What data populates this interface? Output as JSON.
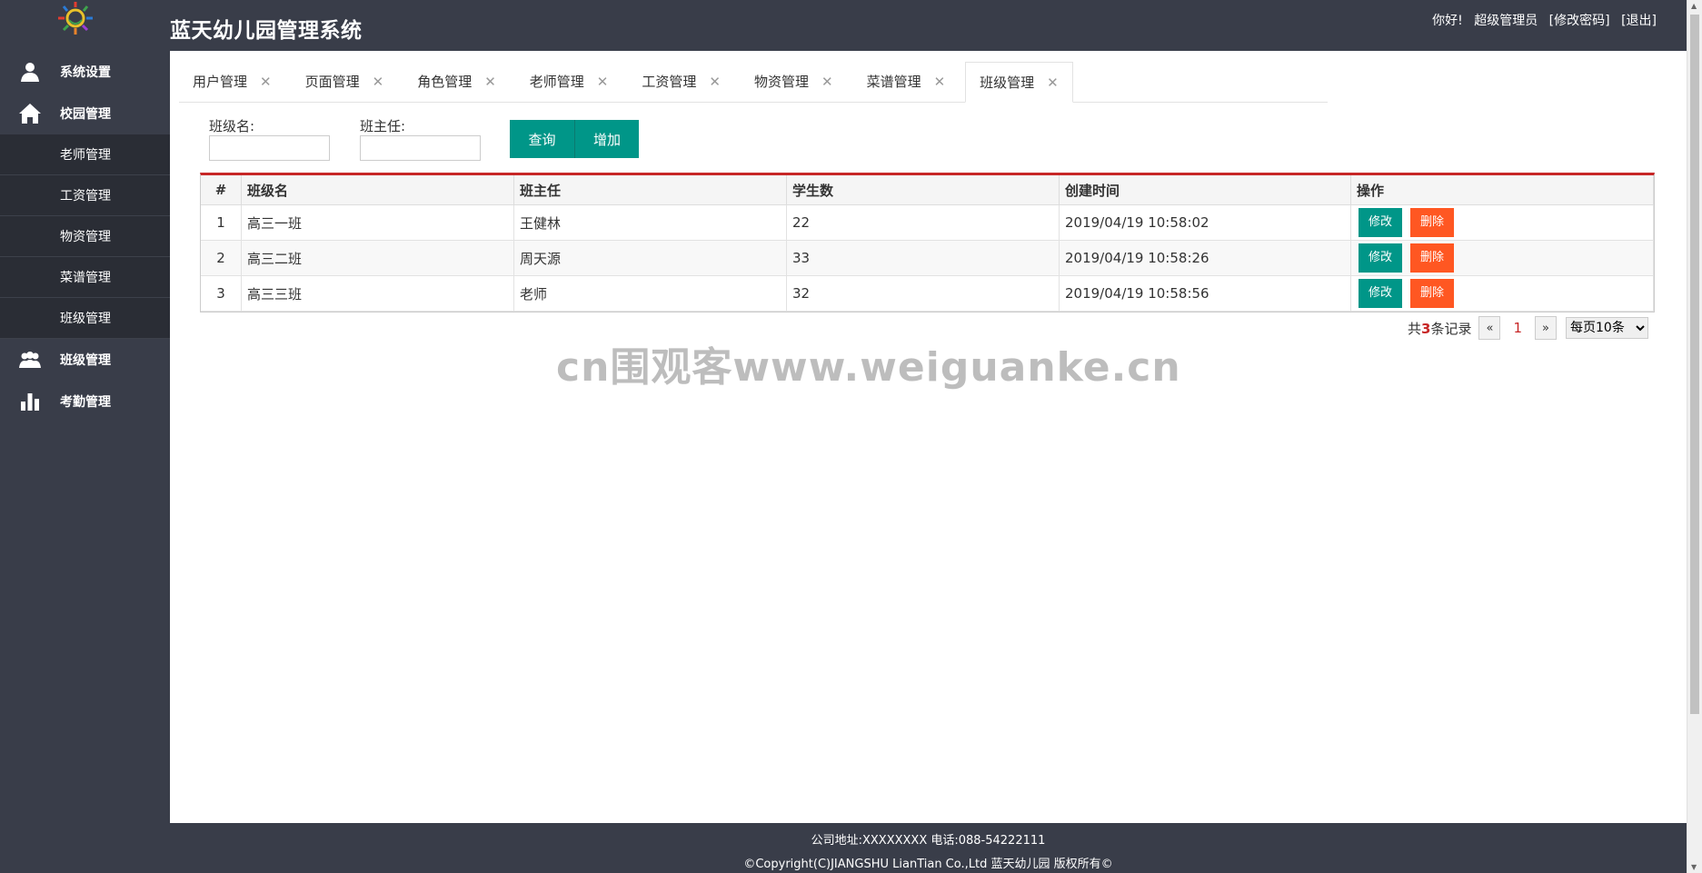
{
  "app": {
    "title": "蓝天幼儿园管理系统"
  },
  "user": {
    "greeting": "你好!",
    "name": "超级管理员",
    "change_password": "[修改密码]",
    "logout": "[退出]"
  },
  "sidebar": {
    "items": [
      {
        "label": "系统设置",
        "icon": "user-icon"
      },
      {
        "label": "校园管理",
        "icon": "home-icon"
      }
    ],
    "sub_items": [
      "老师管理",
      "工资管理",
      "物资管理",
      "菜谱管理",
      "班级管理"
    ],
    "bottom_items": [
      {
        "label": "班级管理",
        "icon": "group-icon"
      },
      {
        "label": "考勤管理",
        "icon": "bar-chart-icon"
      }
    ]
  },
  "tabs": [
    "用户管理",
    "页面管理",
    "角色管理",
    "老师管理",
    "工资管理",
    "物资管理",
    "菜谱管理",
    "班级管理"
  ],
  "active_tab": "班级管理",
  "filters": {
    "class_name_label": "班级名:",
    "class_name_value": "",
    "teacher_label": "班主任:",
    "teacher_value": "",
    "query_button": "查询",
    "add_button": "增加"
  },
  "table": {
    "columns": [
      "#",
      "班级名",
      "班主任",
      "学生数",
      "创建时间",
      "操作"
    ],
    "rows": [
      {
        "num": "1",
        "name": "高三一班",
        "teacher": "王健林",
        "students": "22",
        "created": "2019/04/19 10:58:02"
      },
      {
        "num": "2",
        "name": "高三二班",
        "teacher": "周天源",
        "students": "33",
        "created": "2019/04/19 10:58:26"
      },
      {
        "num": "3",
        "name": "高三三班",
        "teacher": "老师",
        "students": "32",
        "created": "2019/04/19 10:58:56"
      }
    ],
    "edit_label": "修改",
    "delete_label": "删除"
  },
  "pager": {
    "total_prefix": "共",
    "total_count": "3",
    "total_suffix": "条记录",
    "prev": "«",
    "current": "1",
    "next": "»",
    "page_size": "每页10条"
  },
  "watermark": "cn围观客www.weiguanke.cn",
  "footer": {
    "line1": "公司地址:XXXXXXXX 电话:088-54222111",
    "line2": "©Copyright(C)JIANGSHU LianTian Co.,Ltd 蓝天幼儿园 版权所有©"
  },
  "colors": {
    "header_bg": "#393d49",
    "accent_teal": "#009688",
    "danger_orange": "#ff5722",
    "table_top_border": "#c72626"
  }
}
